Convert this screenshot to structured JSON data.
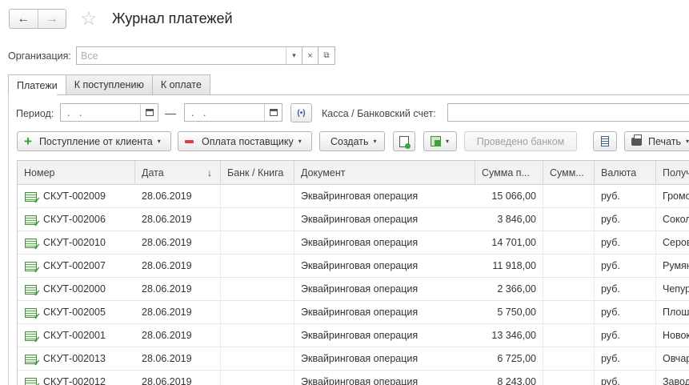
{
  "header": {
    "back_icon": "←",
    "forward_icon": "→",
    "star_icon": "☆",
    "title": "Журнал платежей"
  },
  "org": {
    "label": "Организация:",
    "placeholder": "Все",
    "dropdown_icon": "▾",
    "clear_icon": "×",
    "open_icon": "⧉"
  },
  "tabs": [
    {
      "label": "Платежи",
      "active": true
    },
    {
      "label": "К поступлению",
      "active": false
    },
    {
      "label": "К оплате",
      "active": false
    }
  ],
  "period": {
    "label": "Период:",
    "from": ". .",
    "to": ". .",
    "dash": "—",
    "period_button_icon": "(•)",
    "kassa_label": "Касса / Банковский счет:"
  },
  "toolbar": {
    "incoming": "Поступление от клиента",
    "payment": "Оплата поставщику",
    "create": "Создать",
    "posted": "Проведено банком",
    "print": "Печать",
    "dropdown_arrow": "▾"
  },
  "table": {
    "columns": [
      "Номер",
      "Дата",
      "Банк / Книга",
      "Документ",
      "Сумма п...",
      "Сумм...",
      "Валюта",
      "Получ"
    ],
    "sort_icon": "↓",
    "rows": [
      {
        "number": "СКУТ-002009",
        "date": "28.06.2019",
        "bank": "",
        "document": "Эквайринговая операция",
        "sum": "15 066,00",
        "sum2": "",
        "currency": "руб.",
        "recipient": "Громов"
      },
      {
        "number": "СКУТ-002006",
        "date": "28.06.2019",
        "bank": "",
        "document": "Эквайринговая операция",
        "sum": "3 846,00",
        "sum2": "",
        "currency": "руб.",
        "recipient": "Соколо"
      },
      {
        "number": "СКУТ-002010",
        "date": "28.06.2019",
        "bank": "",
        "document": "Эквайринговая операция",
        "sum": "14 701,00",
        "sum2": "",
        "currency": "руб.",
        "recipient": "Серова"
      },
      {
        "number": "СКУТ-002007",
        "date": "28.06.2019",
        "bank": "",
        "document": "Эквайринговая операция",
        "sum": "11 918,00",
        "sum2": "",
        "currency": "руб.",
        "recipient": "Румянц"
      },
      {
        "number": "СКУТ-002000",
        "date": "28.06.2019",
        "bank": "",
        "document": "Эквайринговая операция",
        "sum": "2 366,00",
        "sum2": "",
        "currency": "руб.",
        "recipient": "Чепурн"
      },
      {
        "number": "СКУТ-002005",
        "date": "28.06.2019",
        "bank": "",
        "document": "Эквайринговая операция",
        "sum": "5 750,00",
        "sum2": "",
        "currency": "руб.",
        "recipient": "Плошко"
      },
      {
        "number": "СКУТ-002001",
        "date": "28.06.2019",
        "bank": "",
        "document": "Эквайринговая операция",
        "sum": "13 346,00",
        "sum2": "",
        "currency": "руб.",
        "recipient": "Новоко"
      },
      {
        "number": "СКУТ-002013",
        "date": "28.06.2019",
        "bank": "",
        "document": "Эквайринговая операция",
        "sum": "6 725,00",
        "sum2": "",
        "currency": "руб.",
        "recipient": "Овчара"
      },
      {
        "number": "СКУТ-002012",
        "date": "28.06.2019",
        "bank": "",
        "document": "Эквайринговая операция",
        "sum": "8 243,00",
        "sum2": "",
        "currency": "руб.",
        "recipient": "Завод"
      }
    ]
  }
}
